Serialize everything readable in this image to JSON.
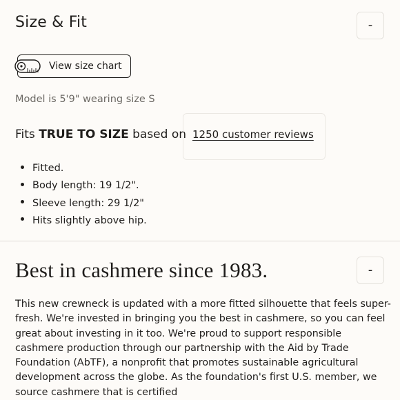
{
  "size_fit": {
    "title": "Size & Fit",
    "toggle_label": "-",
    "size_chart_label": "View size chart",
    "model_note": "Model is 5'9\" wearing size S",
    "fit_prefix": "Fits ",
    "fit_emphasis": "TRUE TO SIZE",
    "fit_suffix": " based on",
    "reviews_link": "1250 customer reviews",
    "details": [
      "Fitted.",
      "Body length: 19 1/2\".",
      "Sleeve length: 29 1/2\"",
      "Hits slightly above hip."
    ]
  },
  "cashmere": {
    "title": "Best in cashmere since 1983.",
    "toggle_label": "-",
    "description": "This new crewneck is updated with a more fitted silhouette that feels super-fresh. We're invested in bringing you the best in cashmere, so you can feel great about investing in it too. We're proud to support responsible cashmere production through our partnership with the Aid by Trade Foundation (AbTF), a nonprofit that promotes sustainable agricultural development across the globe. As the foundation's first U.S. member, we source cashmere that is certified"
  },
  "icons": {
    "size_chart_icon": "measuring-tape-icon"
  },
  "colors": {
    "background": "#fdfbf8",
    "text": "#1f1d1b",
    "muted_text": "#6c6964",
    "border": "#e4e1dc"
  }
}
